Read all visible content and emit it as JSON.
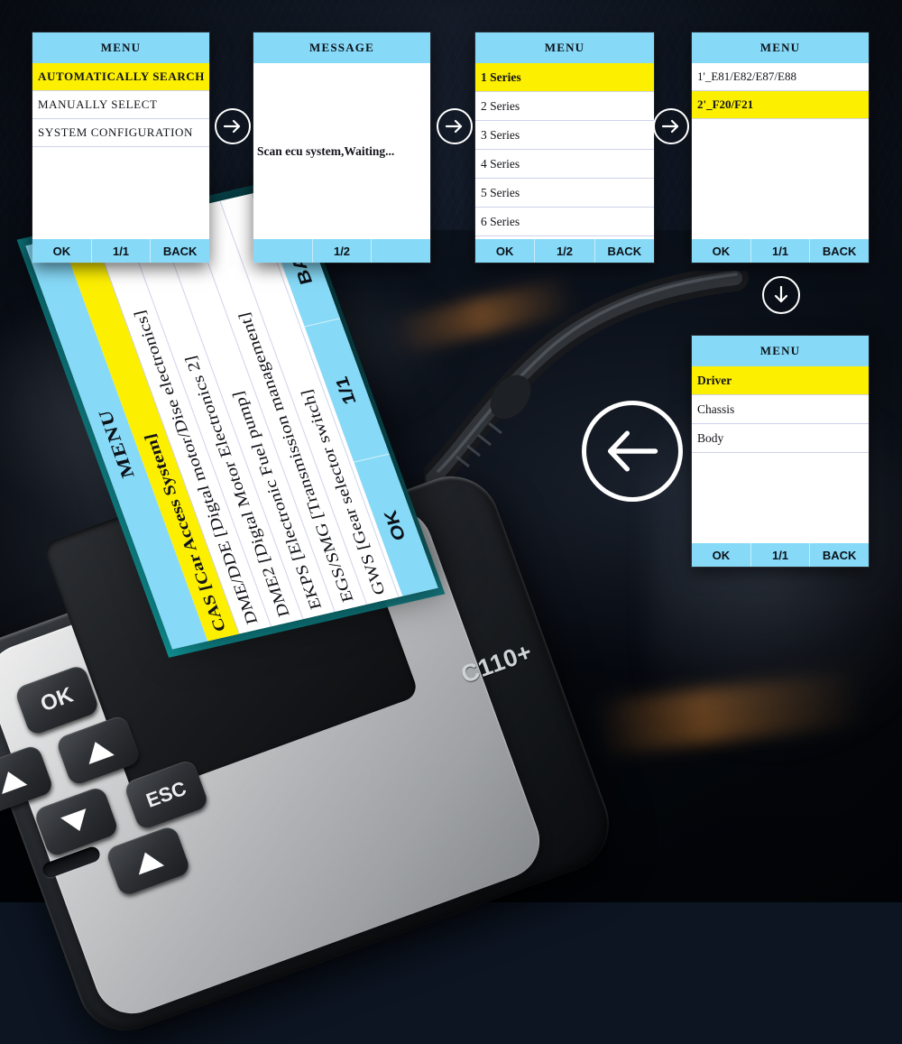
{
  "device": {
    "brand": "C110+",
    "keys": [
      {
        "name": "ok-key",
        "label": "OK"
      },
      {
        "name": "left-up-key",
        "label": "▲"
      },
      {
        "name": "up-key",
        "label": "▲"
      },
      {
        "name": "down-key",
        "label": "▼"
      },
      {
        "name": "esc-key",
        "label": "ESC"
      },
      {
        "name": "bottom-up-key",
        "label": "▲"
      }
    ],
    "esc_label": "ESC",
    "ok_label": "OK"
  },
  "colors": {
    "header_blue": "#86d9f7",
    "highlight_yellow": "#fdef00",
    "screen_white": "#ffffff",
    "text_dark": "#111318",
    "background": "#0a0f18",
    "bezel_teal": "#0f9a9d"
  },
  "icons": {
    "arrow_right": "arrow-right-circle-icon",
    "arrow_down": "arrow-down-circle-icon",
    "arrow_left": "arrow-left-circle-icon"
  },
  "panels": [
    {
      "id": "main-menu",
      "title": "MENU",
      "rows": [
        {
          "label": "AUTOMATICALLY SEARCH",
          "selected": true
        },
        {
          "label": "MANUALLY SELECT",
          "selected": false
        },
        {
          "label": "SYSTEM CONFIGURATION",
          "selected": false
        }
      ],
      "footer": {
        "left": "OK",
        "center": "1/1",
        "right": "BACK"
      }
    },
    {
      "id": "message",
      "title": "MESSAGE",
      "message": "Scan ecu system,Waiting...",
      "footer": {
        "left": "",
        "center": "1/2",
        "right": ""
      }
    },
    {
      "id": "series-menu",
      "title": "MENU",
      "rows": [
        {
          "label": "1 Series",
          "selected": true
        },
        {
          "label": "2 Series",
          "selected": false
        },
        {
          "label": "3 Series",
          "selected": false
        },
        {
          "label": "4 Series",
          "selected": false
        },
        {
          "label": "5 Series",
          "selected": false
        },
        {
          "label": "6 Series",
          "selected": false
        }
      ],
      "footer": {
        "left": "OK",
        "center": "1/2",
        "right": "BACK"
      }
    },
    {
      "id": "chassis-menu",
      "title": "MENU",
      "rows": [
        {
          "label": "1'_E81/E82/E87/E88",
          "selected": false
        },
        {
          "label": "2'_F20/F21",
          "selected": true
        }
      ],
      "footer": {
        "left": "OK",
        "center": "1/1",
        "right": "BACK"
      }
    },
    {
      "id": "category-menu",
      "title": "MENU",
      "rows": [
        {
          "label": "Driver",
          "selected": true
        },
        {
          "label": "Chassis",
          "selected": false
        },
        {
          "label": "Body",
          "selected": false
        }
      ],
      "footer": {
        "left": "OK",
        "center": "1/1",
        "right": "BACK"
      }
    },
    {
      "id": "ecu-menu",
      "title": "MENU",
      "rows": [
        {
          "label": "CAS [Car Access System]",
          "selected": true
        },
        {
          "label": "DME/DDE [Digtal motor/Dise electronics]",
          "selected": false
        },
        {
          "label": "DME2 [Digtal Motor Electronics 2]",
          "selected": false
        },
        {
          "label": "EKPS [Electronic Fuel pump]",
          "selected": false
        },
        {
          "label": "EGS/SMG [Transmission management]",
          "selected": false
        },
        {
          "label": "GWS [Gear selector switch]",
          "selected": false
        }
      ],
      "footer": {
        "left": "OK",
        "center": "1/1",
        "right": "BACK"
      }
    }
  ]
}
